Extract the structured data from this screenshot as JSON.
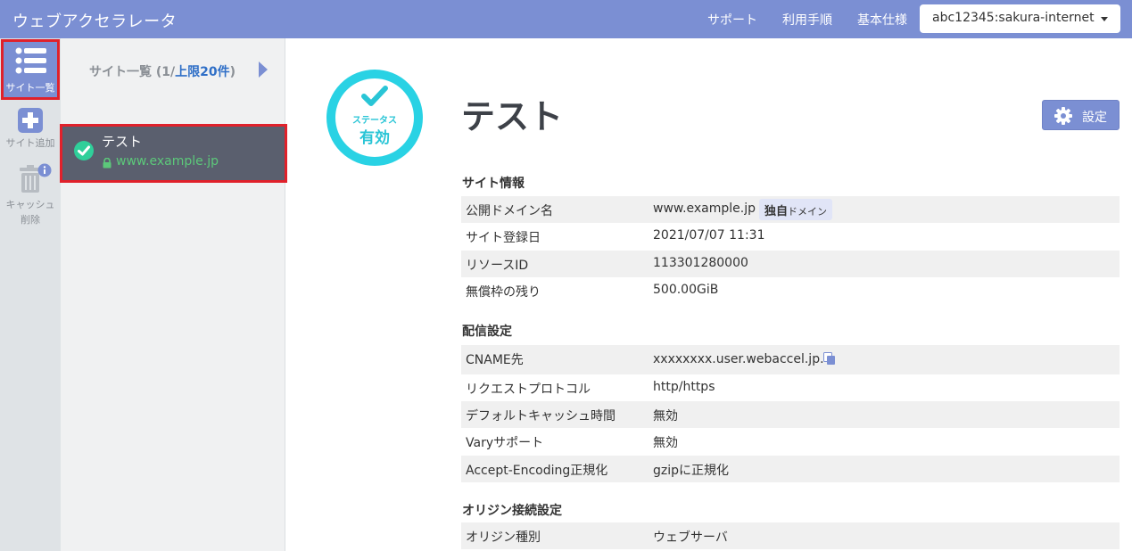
{
  "header": {
    "app_title": "ウェブアクセラレータ",
    "nav": [
      "サポート",
      "利用手順",
      "基本仕様"
    ],
    "account": "abc12345:sakura-internet"
  },
  "iconbar": {
    "site_list": "サイト一覧",
    "add_site": "サイト追加",
    "cache_delete_1": "キャッシュ",
    "cache_delete_2": "削除"
  },
  "sitelist": {
    "title_prefix": "サイト一覧 (1/",
    "limit": "上限20件",
    "title_suffix": ")",
    "items": [
      {
        "name": "テスト",
        "domain": "www.example.jp"
      }
    ]
  },
  "status": {
    "label": "ステータス",
    "value": "有効"
  },
  "site": {
    "name": "テスト",
    "settings_label": "設定"
  },
  "sections": {
    "site_info": {
      "title": "サイト情報",
      "rows": [
        {
          "key": "公開ドメイン名",
          "value": "www.example.jp",
          "badge_strong": "独自",
          "badge_small": "ドメイン"
        },
        {
          "key": "サイト登録日",
          "value": "2021/07/07 11:31"
        },
        {
          "key": "リソースID",
          "value": "113301280000"
        },
        {
          "key": "無償枠の残り",
          "value": "500.00GiB"
        }
      ]
    },
    "delivery": {
      "title": "配信設定",
      "rows": [
        {
          "key": "CNAME先",
          "value": "xxxxxxxx.user.webaccel.jp."
        },
        {
          "key": "リクエストプロトコル",
          "value": "http/https"
        },
        {
          "key": "デフォルトキャッシュ時間",
          "value": "無効"
        },
        {
          "key": "Varyサポート",
          "value": "無効"
        },
        {
          "key": "Accept-Encoding正規化",
          "value": "gzipに正規化"
        }
      ]
    },
    "origin": {
      "title": "オリジン接続設定",
      "rows": [
        {
          "key": "オリジン種別",
          "value": "ウェブサーバ"
        }
      ]
    }
  },
  "colors": {
    "header": "#7b8fd3",
    "status": "#29d2e4",
    "highlight": "#e0212b",
    "active_check": "#2fcf9a"
  },
  "icons": [
    "list-icon",
    "plus-icon",
    "trash-icon",
    "info-icon",
    "check-icon",
    "lock-icon",
    "gear-icon",
    "copy-icon",
    "caret-down-icon",
    "arrow-right-icon"
  ]
}
